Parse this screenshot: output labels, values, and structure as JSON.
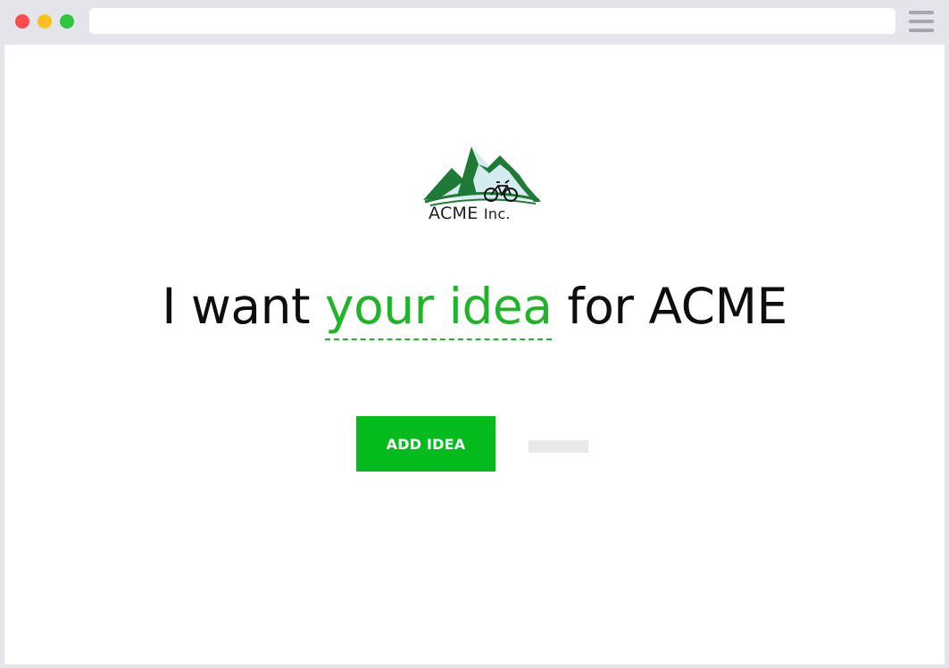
{
  "browser": {
    "url": "",
    "controls": [
      "close",
      "minimize",
      "maximize"
    ],
    "menu_icon": "hamburger-menu-icon"
  },
  "logo": {
    "brand": "ACME",
    "suffix": "Inc.",
    "colors": {
      "mountain": "#1e7a36",
      "sky": "#d4ecef",
      "text": "#1c1c1c"
    }
  },
  "headline": {
    "prefix": "I want",
    "highlight": "your idea",
    "suffix": "for ACME"
  },
  "actions": {
    "add_idea_label": "ADD IDEA"
  },
  "colors": {
    "accent": "#21b42a",
    "button": "#04bb1d"
  }
}
